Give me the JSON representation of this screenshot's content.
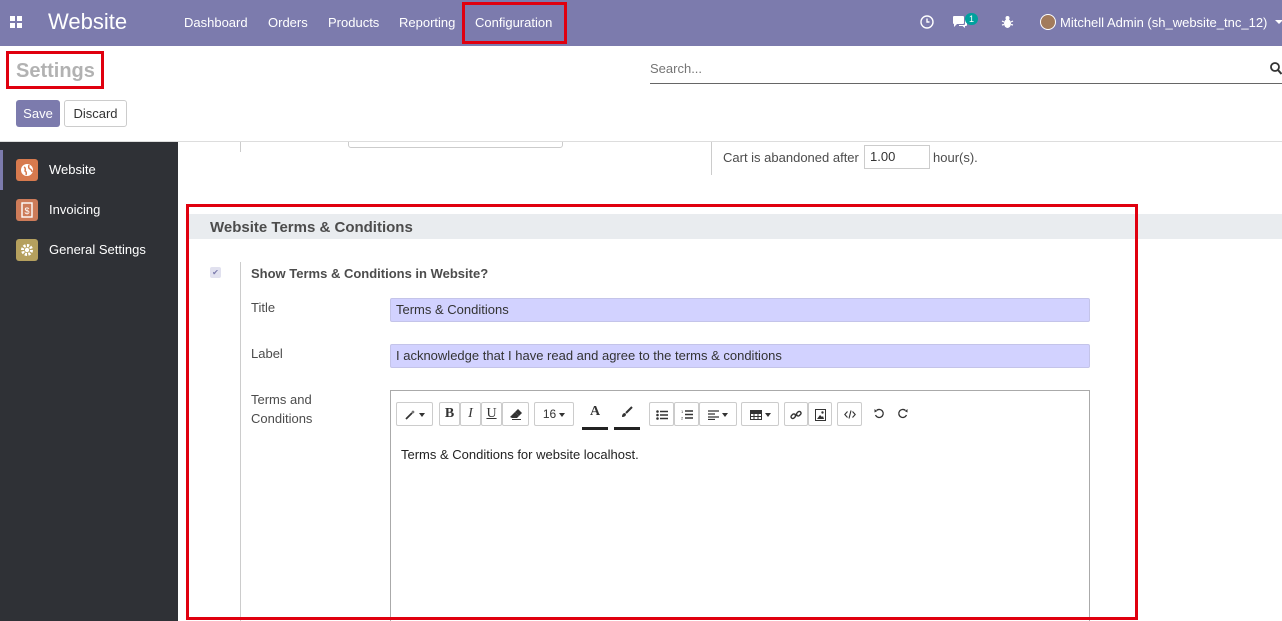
{
  "navbar": {
    "brand": "Website",
    "menu": [
      "Dashboard",
      "Orders",
      "Products",
      "Reporting",
      "Configuration"
    ],
    "chat_count": "1",
    "user": "Mitchell Admin (sh_website_tnc_12)"
  },
  "control_panel": {
    "title": "Settings",
    "search_placeholder": "Search...",
    "save_label": "Save",
    "discard_label": "Discard"
  },
  "sidebar": {
    "items": [
      {
        "label": "Website",
        "icon": "globe-icon",
        "color": "#d77a4e"
      },
      {
        "label": "Invoicing",
        "icon": "invoice-icon",
        "color": "#cd7b59"
      },
      {
        "label": "General Settings",
        "icon": "gear-icon",
        "color": "#b5a05e"
      }
    ]
  },
  "prev_section": {
    "cart_prefix": "Cart is abandoned after",
    "cart_value": "1.00",
    "cart_suffix": "hour(s)."
  },
  "terms_section": {
    "header": "Website Terms & Conditions",
    "show_label": "Show Terms & Conditions in Website?",
    "show_checked": true,
    "title_label": "Title",
    "title_value": "Terms & Conditions",
    "label_label": "Label",
    "label_value": "I acknowledge that I have read and agree to the terms & conditions",
    "tc_label": "Terms and Conditions",
    "tc_text": "Terms & Conditions for website localhost."
  },
  "editor_toolbar": {
    "font_size": "16"
  },
  "colors": {
    "primary": "#7c7bad",
    "sidebar_bg": "#2f3136",
    "highlight": "#e0000f"
  }
}
